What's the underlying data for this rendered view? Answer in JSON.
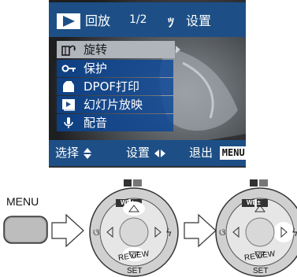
{
  "lcd": {
    "play_tab_label": "回放",
    "play_page": "1/2",
    "setup_tab_label": "设置",
    "menu_items": [
      {
        "label": "旋转",
        "icon": "rotate-icon",
        "selected": true
      },
      {
        "label": "保护",
        "icon": "key-icon",
        "selected": false
      },
      {
        "label": "DPOF打印",
        "icon": "print-icon",
        "selected": false
      },
      {
        "label": "幻灯片放映",
        "icon": "slideshow-icon",
        "selected": false
      },
      {
        "label": "配音",
        "icon": "microphone-icon",
        "selected": false
      }
    ],
    "bottom": {
      "select_label": "选择",
      "set_label": "设置",
      "exit_label": "退出",
      "menu_badge": "MENU"
    }
  },
  "diagram": {
    "menu_caption": "MENU",
    "review_label": "REVIEW",
    "set_label": "SET",
    "wb_badge": "WB±",
    "colors": {
      "dial_gray": "#cfcfcf",
      "highlight": "#ffffff",
      "outline": "#555555"
    }
  }
}
